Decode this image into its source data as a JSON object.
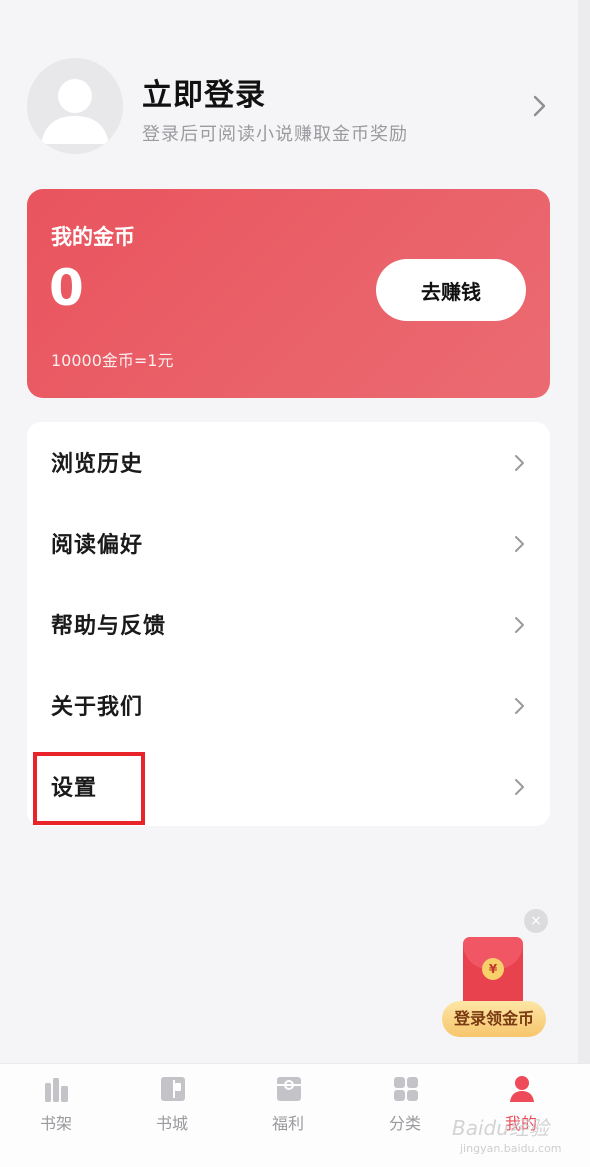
{
  "profile": {
    "title": "立即登录",
    "subtitle": "登录后可阅读小说赚取金币奖励"
  },
  "coins": {
    "label": "我的金币",
    "value": "0",
    "rate": "10000金币=1元",
    "earn_button": "去赚钱"
  },
  "menu": {
    "items": [
      {
        "label": "浏览历史"
      },
      {
        "label": "阅读偏好"
      },
      {
        "label": "帮助与反馈"
      },
      {
        "label": "关于我们"
      },
      {
        "label": "设置"
      }
    ]
  },
  "floating_promo": {
    "coin_symbol": "¥",
    "label": "登录领金币",
    "close": "×"
  },
  "bottom_nav": {
    "items": [
      {
        "label": "书架",
        "icon": "bookshelf-icon"
      },
      {
        "label": "书城",
        "icon": "bookstore-icon"
      },
      {
        "label": "福利",
        "icon": "gift-icon"
      },
      {
        "label": "分类",
        "icon": "category-icon"
      },
      {
        "label": "我的",
        "icon": "profile-icon"
      }
    ],
    "active_index": 4
  },
  "watermark": {
    "main": "Baidu经验",
    "sub": "jingyan.baidu.com"
  },
  "colors": {
    "accent": "#ee4a5a",
    "card_gradient_start": "#e9545e",
    "card_gradient_end": "#eb6b72",
    "highlight": "#e8232a"
  }
}
